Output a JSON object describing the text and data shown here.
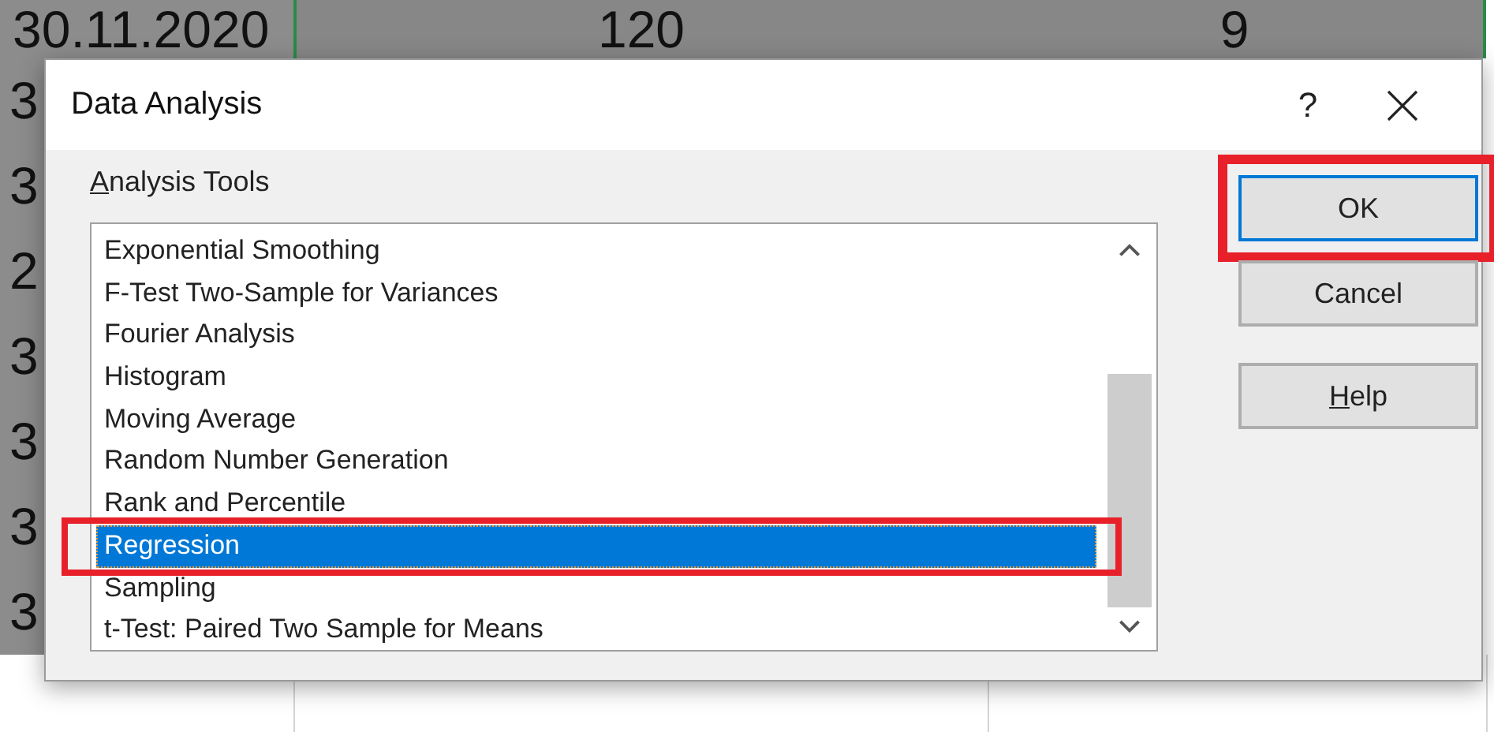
{
  "sheet": {
    "top_row": [
      "30.11.2020",
      "120",
      "9"
    ],
    "left_column": [
      "3",
      "3",
      "2",
      "3",
      "3",
      "3",
      "3"
    ]
  },
  "dialog": {
    "title": "Data Analysis",
    "help_glyph": "?",
    "list_label": {
      "text": "Analysis Tools",
      "mnemonic_first": true
    },
    "items": [
      {
        "label": "Exponential Smoothing",
        "selected": false,
        "highlighted": false
      },
      {
        "label": "F-Test Two-Sample for Variances",
        "selected": false,
        "highlighted": false
      },
      {
        "label": "Fourier Analysis",
        "selected": false,
        "highlighted": false
      },
      {
        "label": "Histogram",
        "selected": false,
        "highlighted": false
      },
      {
        "label": "Moving Average",
        "selected": false,
        "highlighted": false
      },
      {
        "label": "Random Number Generation",
        "selected": false,
        "highlighted": false
      },
      {
        "label": "Rank and Percentile",
        "selected": false,
        "highlighted": false
      },
      {
        "label": "Regression",
        "selected": true,
        "highlighted": true
      },
      {
        "label": "Sampling",
        "selected": false,
        "highlighted": false
      },
      {
        "label": "t-Test: Paired Two Sample for Means",
        "selected": false,
        "highlighted": false
      }
    ],
    "buttons": [
      {
        "label": "OK",
        "default": true,
        "highlighted": true,
        "mnemonic_first": false
      },
      {
        "label": "Cancel",
        "default": false,
        "highlighted": false,
        "mnemonic_first": false
      },
      {
        "label": "Help",
        "default": false,
        "highlighted": false,
        "mnemonic_first": true
      }
    ]
  }
}
